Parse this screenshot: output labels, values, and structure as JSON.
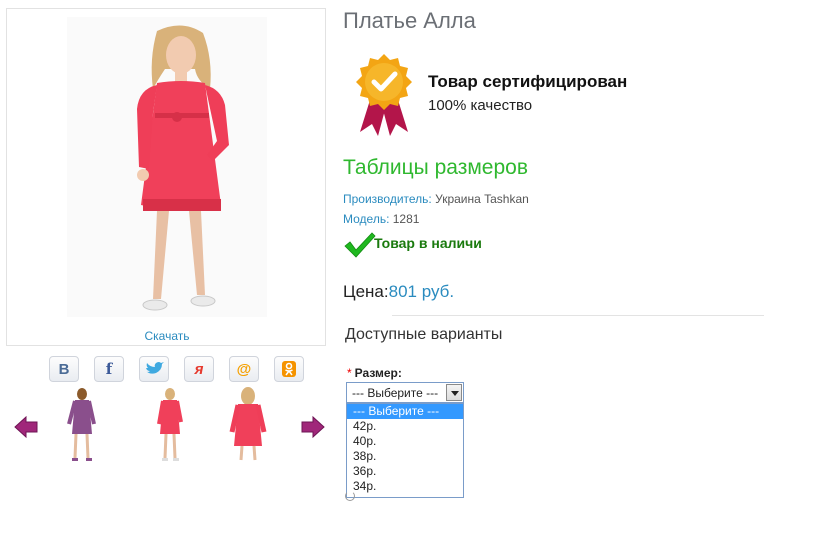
{
  "product": {
    "title": "Платье Алла",
    "download_label": "Скачать"
  },
  "certificate": {
    "title": "Товар сертифицирован",
    "subtitle": "100% качество"
  },
  "size_table_link": "Таблицы размеров",
  "meta": {
    "manufacturer_label": "Производитель:",
    "manufacturer_value": "Украина Tashkan",
    "model_label": "Модель:",
    "model_value": "1281"
  },
  "stock": {
    "text": "Товар в наличи"
  },
  "price": {
    "label": "Цена:",
    "value": "801 руб."
  },
  "variants": {
    "title": "Доступные варианты",
    "size_label": "Размер:",
    "required_mark": "*",
    "selected": "--- Выберите ---",
    "options": [
      "--- Выберите ---",
      "42р.",
      "40р.",
      "38р.",
      "36р.",
      "34р."
    ]
  },
  "social": [
    {
      "icon": "vk-icon",
      "glyph": "В",
      "color": "#4a6b96"
    },
    {
      "icon": "facebook-icon",
      "glyph": "f",
      "color": "#3b5998"
    },
    {
      "icon": "twitter-icon",
      "glyph": "🐦",
      "color": "#3fa9e0"
    },
    {
      "icon": "moikrug-icon",
      "glyph": "я",
      "color": "#e63a2e"
    },
    {
      "icon": "mailru-icon",
      "glyph": "@",
      "color": "#f5a000"
    },
    {
      "icon": "odnoklassniki-icon",
      "glyph": "ок",
      "color": "#f59300"
    }
  ],
  "colors": {
    "link": "#2a8bbf",
    "green_title": "#2fb82f",
    "stock_green": "#1a7a0e",
    "dress_main": "#f0405a",
    "dress_purple": "#8a4f8c",
    "arrow_purple": "#a0277a"
  }
}
